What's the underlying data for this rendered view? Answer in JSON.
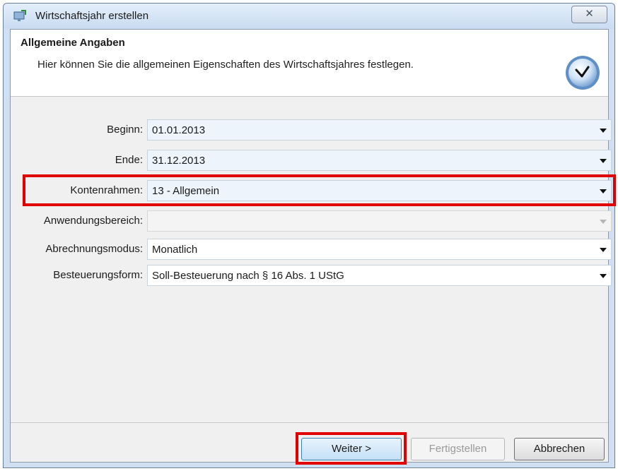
{
  "window": {
    "title": "Wirtschaftsjahr erstellen",
    "close_label": "✕"
  },
  "header": {
    "title": "Allgemeine Angaben",
    "description": "Hier können Sie die allgemeinen Eigenschaften des Wirtschaftsjahres festlegen."
  },
  "fields": {
    "beginn": {
      "label": "Beginn:",
      "value": "01.01.2013"
    },
    "ende": {
      "label": "Ende:",
      "value": "31.12.2013"
    },
    "kontenrahmen": {
      "label": "Kontenrahmen:",
      "value": "13 - Allgemein"
    },
    "anwendungsbereich": {
      "label": "Anwendungsbereich:",
      "value": ""
    },
    "abrechnungsmodus": {
      "label": "Abrechnungsmodus:",
      "value": "Monatlich"
    },
    "besteuerungsform": {
      "label": "Besteuerungsform:",
      "value": "Soll-Besteuerung nach § 16 Abs. 1 UStG"
    }
  },
  "buttons": {
    "weiter": "Weiter >",
    "fertigstellen": "Fertigstellen",
    "abbrechen": "Abbrechen"
  },
  "colors": {
    "highlight": "#e00000",
    "field_highlight_bg": "#eef4fc"
  },
  "icons": {
    "title": "wizard-app-icon",
    "header": "clock-icon"
  }
}
